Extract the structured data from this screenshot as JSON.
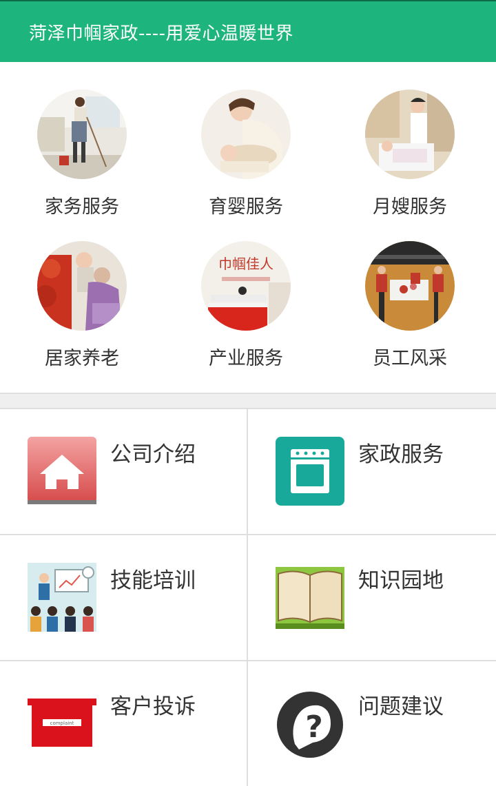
{
  "header": {
    "title": "菏泽巾帼家政----用爱心温暖世界"
  },
  "services": [
    {
      "label": "家务服务",
      "icon": "housework-photo"
    },
    {
      "label": "育婴服务",
      "icon": "babycare-photo"
    },
    {
      "label": "月嫂服务",
      "icon": "maternity-photo"
    },
    {
      "label": "居家养老",
      "icon": "eldercare-photo"
    },
    {
      "label": "产业服务",
      "icon": "industry-photo",
      "photo_text": "巾帼佳人"
    },
    {
      "label": "员工风采",
      "icon": "staff-photo"
    }
  ],
  "menu": [
    {
      "label": "公司介绍",
      "icon": "home-icon",
      "color": "#e06666"
    },
    {
      "label": "家政服务",
      "icon": "stove-icon",
      "color": "#19a99a"
    },
    {
      "label": "技能培训",
      "icon": "training-icon"
    },
    {
      "label": "知识园地",
      "icon": "book-icon"
    },
    {
      "label": "客户投诉",
      "icon": "complaint-icon",
      "color": "#d9121b",
      "icon_text": "complaint"
    },
    {
      "label": "问题建议",
      "icon": "question-icon",
      "color": "#333333"
    }
  ]
}
